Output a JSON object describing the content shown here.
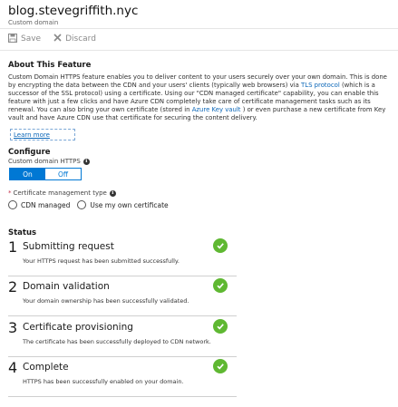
{
  "header": {
    "title": "blog.stevegriffith.nyc",
    "subtitle": "Custom domain"
  },
  "toolbar": {
    "save_label": "Save",
    "discard_label": "Discard"
  },
  "about": {
    "heading": "About This Feature",
    "text_1": "Custom Domain HTTPS feature enables you to deliver content to your users securely over your own domain. This is done by encrypting the data between the CDN and your users' clients (typically web browsers) via ",
    "link_tls": "TLS protocol",
    "text_2": " (which is a successor of the SSL protocol) using a certificate. Using our \"CDN managed certificate\" capability, you can enable this feature with just a few clicks and have Azure CDN completely take care of certificate management tasks such as its renewal. You can also bring your own certificate (stored in ",
    "link_keyvault": "Azure Key vault",
    "text_3": " ) or even purchase a new certificate from Key vault and have Azure CDN use that certificate for securing the content delivery.",
    "learn_more": "Learn more"
  },
  "configure": {
    "heading": "Configure",
    "https_label": "Custom domain HTTPS",
    "toggle_on": "On",
    "toggle_off": "Off",
    "cert_type_label": "Certificate management type",
    "required_mark": "*",
    "options": [
      "CDN managed",
      "Use my own certificate"
    ]
  },
  "status": {
    "heading": "Status",
    "steps": [
      {
        "number": "1",
        "title": "Submitting request",
        "description": "Your HTTPS request has been submitted successfully."
      },
      {
        "number": "2",
        "title": "Domain validation",
        "description": "Your domain ownership has been successfully validated."
      },
      {
        "number": "3",
        "title": "Certificate provisioning",
        "description": "The certificate has been successfully deployed to CDN network."
      },
      {
        "number": "4",
        "title": "Complete",
        "description": "HTTPS has been successfully enabled on your domain."
      }
    ]
  },
  "colors": {
    "accent": "#0078d4",
    "success": "#5fb832",
    "link": "#0a66b8"
  },
  "icons": [
    "save-icon",
    "discard-icon",
    "info-icon",
    "checkmark-icon"
  ]
}
